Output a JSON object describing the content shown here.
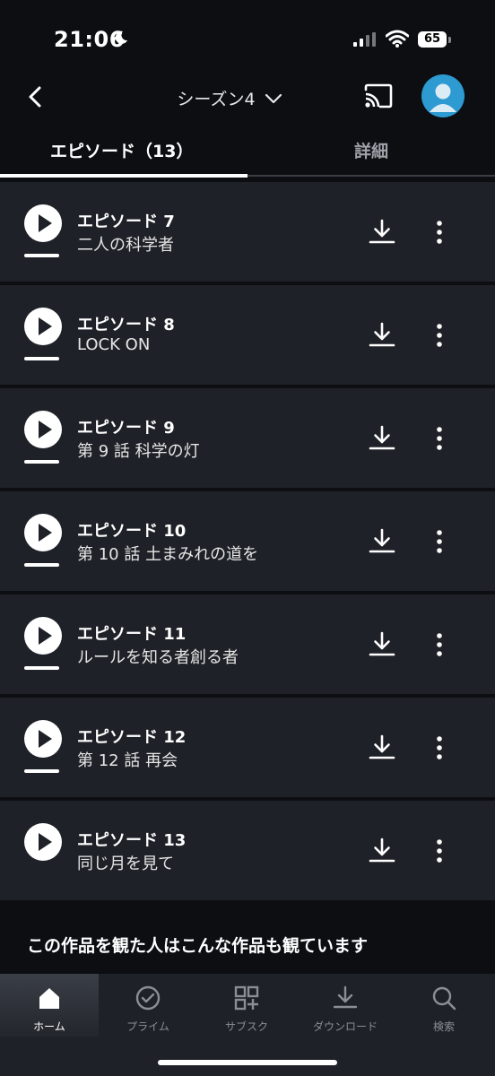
{
  "status": {
    "time": "21:06",
    "battery": "65"
  },
  "header": {
    "season_label": "シーズン4",
    "icons": [
      "back-icon",
      "chevron-down-icon",
      "cast-icon",
      "avatar"
    ]
  },
  "tabs": {
    "episodes_label": "エピソード（13）",
    "details_label": "詳細"
  },
  "episodes": [
    {
      "title": "エピソード 7",
      "subtitle": "二人の科学者",
      "progress": 1.0
    },
    {
      "title": "エピソード 8",
      "subtitle": "LOCK ON",
      "progress": 1.0
    },
    {
      "title": "エピソード 9",
      "subtitle": "第 9 話 科学の灯",
      "progress": 1.0
    },
    {
      "title": "エピソード 10",
      "subtitle": "第 10 話 土まみれの道を",
      "progress": 1.0
    },
    {
      "title": "エピソード 11",
      "subtitle": "ルールを知る者創る者",
      "progress": 1.0
    },
    {
      "title": "エピソード 12",
      "subtitle": "第 12 話 再会",
      "progress": 1.0
    },
    {
      "title": "エピソード 13",
      "subtitle": "同じ月を見て",
      "progress": 0
    }
  ],
  "recommend_heading": "この作品を観た人はこんな作品も観ています",
  "nav": {
    "items": [
      {
        "label": "ホーム",
        "icon": "home-icon",
        "active": true
      },
      {
        "label": "プライム",
        "icon": "check-circle-icon",
        "active": false
      },
      {
        "label": "サブスク",
        "icon": "grid-plus-icon",
        "active": false
      },
      {
        "label": "ダウンロード",
        "icon": "download-icon",
        "active": false
      },
      {
        "label": "検索",
        "icon": "search-icon",
        "active": false
      }
    ]
  },
  "colors": {
    "background": "#0c0e12",
    "row": "#1e2127",
    "accent": "#2d9ad2"
  }
}
